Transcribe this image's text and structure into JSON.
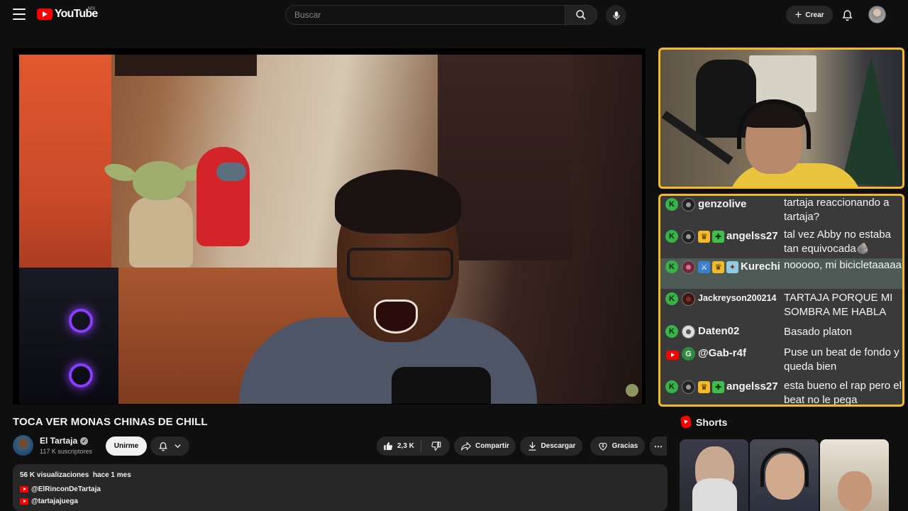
{
  "header": {
    "logo_text": "YouTube",
    "country": "MX",
    "search_placeholder": "Buscar",
    "create_label": "Crear"
  },
  "video": {
    "title": "TOCA VER MONAS CHINAS DE CHILL",
    "channel_name": "El Tartaja",
    "subscribers": "117 K suscriptores",
    "join_label": "Unirme",
    "likes": "2,3 K",
    "share_label": "Compartir",
    "download_label": "Descargar",
    "thanks_label": "Gracias"
  },
  "description": {
    "views": "56 K visualizaciones",
    "age": "hace 1 mes",
    "links": [
      "@ElRinconDeTartaja",
      "@tartajajuega"
    ]
  },
  "chat": {
    "colors": {
      "border": "#f2b929",
      "kick": "#37b34a",
      "background": "#3a3a3a"
    },
    "messages": [
      {
        "platform": "kick",
        "user": "genzolive",
        "badges": [],
        "text": "tartaja reaccionando a tartaja?"
      },
      {
        "platform": "kick",
        "user": "angelss27",
        "badges": [
          "crown-icon",
          "puzzle-icon"
        ],
        "text": "tal vez Abby no estaba tan equivocada🪨"
      },
      {
        "platform": "kick",
        "user": "Kurechi",
        "badges": [
          "sword-icon",
          "crown-icon",
          "gift-icon"
        ],
        "text": "nooooo, mi bicicletaaaaa"
      },
      {
        "platform": "kick",
        "user": "Jackreyson200214",
        "badges": [],
        "text": "TARTAJA PORQUE MI SOMBRA ME HABLA"
      },
      {
        "platform": "kick",
        "user": "Daten02",
        "badges": [],
        "text": "Basado platon"
      },
      {
        "platform": "youtube",
        "user": "@Gab-r4f",
        "badges": [],
        "text": "Puse un beat de fondo y queda bien"
      },
      {
        "platform": "kick",
        "user": "angelss27",
        "badges": [
          "crown-icon",
          "puzzle-icon"
        ],
        "text": "esta bueno el rap pero el beat no le pega"
      }
    ]
  },
  "shorts": {
    "heading": "Shorts"
  }
}
